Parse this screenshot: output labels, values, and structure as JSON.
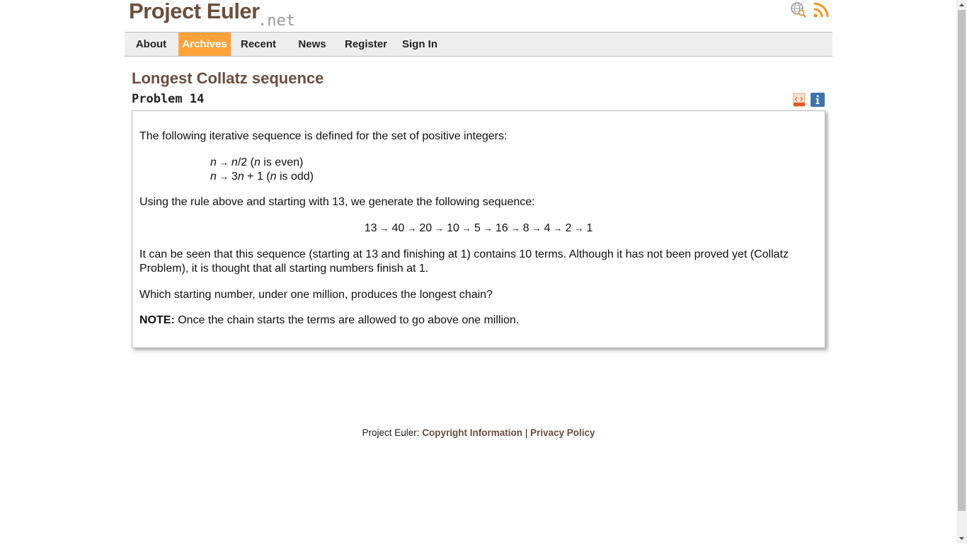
{
  "header": {
    "logo_main": "Project Euler",
    "logo_suffix": ".net",
    "icons": [
      "search-globe-icon",
      "rss-icon"
    ]
  },
  "nav": {
    "items": [
      {
        "label": "About",
        "active": false
      },
      {
        "label": "Archives",
        "active": true
      },
      {
        "label": "Recent",
        "active": false
      },
      {
        "label": "News",
        "active": false
      },
      {
        "label": "Register",
        "active": false
      },
      {
        "label": "Sign In",
        "active": false
      }
    ]
  },
  "problem": {
    "title": "Longest Collatz sequence",
    "number_label": "Problem 14",
    "icons": [
      "html-source-icon",
      "info-icon"
    ],
    "intro": "The following iterative sequence is defined for the set of positive integers:",
    "rule_even": {
      "a": "n",
      "arrow": "→",
      "b": "n",
      "c": "/2 (",
      "d": "n",
      "e": " is even)"
    },
    "rule_odd": {
      "a": "n",
      "arrow": "→",
      "b": "3",
      "c": "n",
      "d": " + 1 (",
      "e": "n",
      "f": " is odd)"
    },
    "example_intro": "Using the rule above and starting with 13, we generate the following sequence:",
    "sequence": [
      "13",
      "40",
      "20",
      "10",
      "5",
      "16",
      "8",
      "4",
      "2",
      "1"
    ],
    "explanation": "It can be seen that this sequence (starting at 13 and finishing at 1) contains 10 terms. Although it has not been proved yet (Collatz Problem), it is thought that all starting numbers finish at 1.",
    "question": "Which starting number, under one million, produces the longest chain?",
    "note_label": "NOTE:",
    "note_text": " Once the chain starts the terms are allowed to go above one million."
  },
  "footer": {
    "prefix": "Project Euler: ",
    "copyright_link": "Copyright Information",
    "separator": " | ",
    "privacy_link": "Privacy Policy"
  },
  "colors": {
    "brand": "#6b4e3d",
    "nav_active": "#ffa23a",
    "nav_bg": "#eeeeee"
  }
}
